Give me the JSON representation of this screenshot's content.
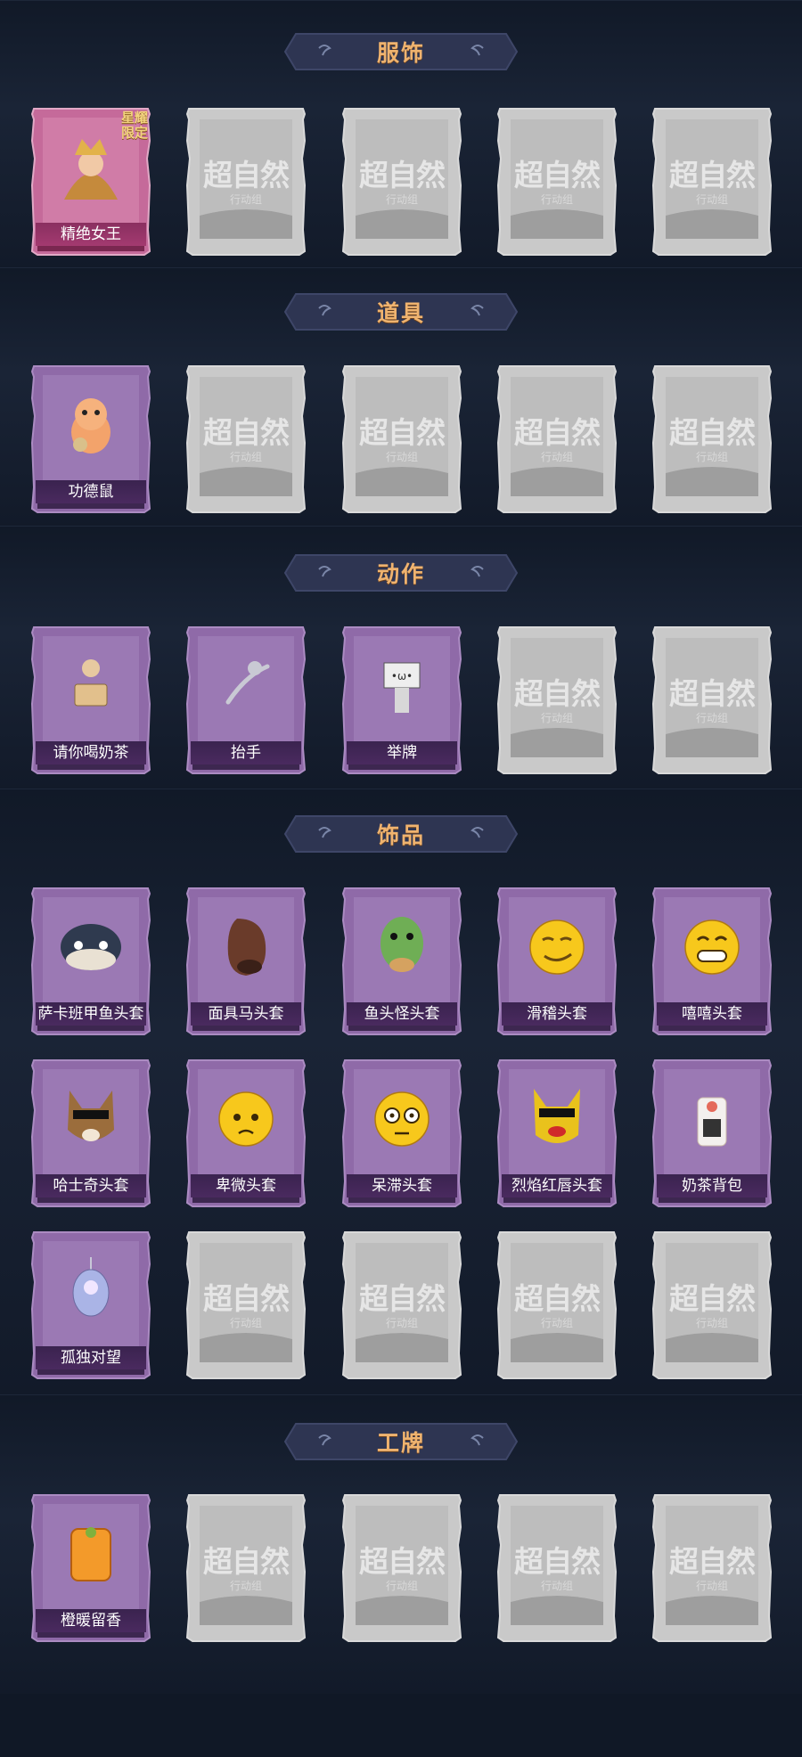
{
  "placeholder": {
    "emblem": "超自然",
    "sub": "行动组"
  },
  "sections": [
    {
      "title": "服饰",
      "cards": [
        {
          "label": "精绝女王",
          "art": "queen-portrait",
          "tag": "星耀限定",
          "style": "gold"
        },
        {
          "placeholder": true
        },
        {
          "placeholder": true
        },
        {
          "placeholder": true
        },
        {
          "placeholder": true
        }
      ]
    },
    {
      "title": "道具",
      "cards": [
        {
          "label": "功德鼠",
          "art": "hamster-figure"
        },
        {
          "placeholder": true
        },
        {
          "placeholder": true
        },
        {
          "placeholder": true
        },
        {
          "placeholder": true
        }
      ]
    },
    {
      "title": "动作",
      "cards": [
        {
          "label": "请你喝奶茶",
          "art": "milk-tea-pose"
        },
        {
          "label": "抬手",
          "art": "raise-hand-pose"
        },
        {
          "label": "举牌",
          "art": "hold-sign-pose"
        },
        {
          "placeholder": true
        },
        {
          "placeholder": true
        }
      ]
    },
    {
      "title": "饰品",
      "cards": [
        {
          "label": "萨卡班甲鱼头套",
          "art": "fish-mask"
        },
        {
          "label": "面具马头套",
          "art": "horse-mask"
        },
        {
          "label": "鱼头怪头套",
          "art": "fishhead-mask"
        },
        {
          "label": "滑稽头套",
          "art": "smirk-face"
        },
        {
          "label": "嘻嘻头套",
          "art": "grin-face"
        },
        {
          "label": "哈士奇头套",
          "art": "husky-mask"
        },
        {
          "label": "卑微头套",
          "art": "pleading-face"
        },
        {
          "label": "呆滞头套",
          "art": "blank-face"
        },
        {
          "label": "烈焰红唇头套",
          "art": "pika-mask"
        },
        {
          "label": "奶茶背包",
          "art": "milk-tea-bag"
        },
        {
          "label": "孤独对望",
          "art": "pendant"
        },
        {
          "placeholder": true
        },
        {
          "placeholder": true
        },
        {
          "placeholder": true
        },
        {
          "placeholder": true
        }
      ]
    },
    {
      "title": "工牌",
      "cards": [
        {
          "label": "橙暖留香",
          "art": "orange-badge"
        },
        {
          "placeholder": true
        },
        {
          "placeholder": true
        },
        {
          "placeholder": true
        },
        {
          "placeholder": true
        }
      ]
    }
  ],
  "colors": {
    "background": "#101826",
    "banner": "#2e3552",
    "banner_text": "#efb36f",
    "owned_card": "#8f6aa8",
    "placeholder_card": "#c9c9c9"
  }
}
